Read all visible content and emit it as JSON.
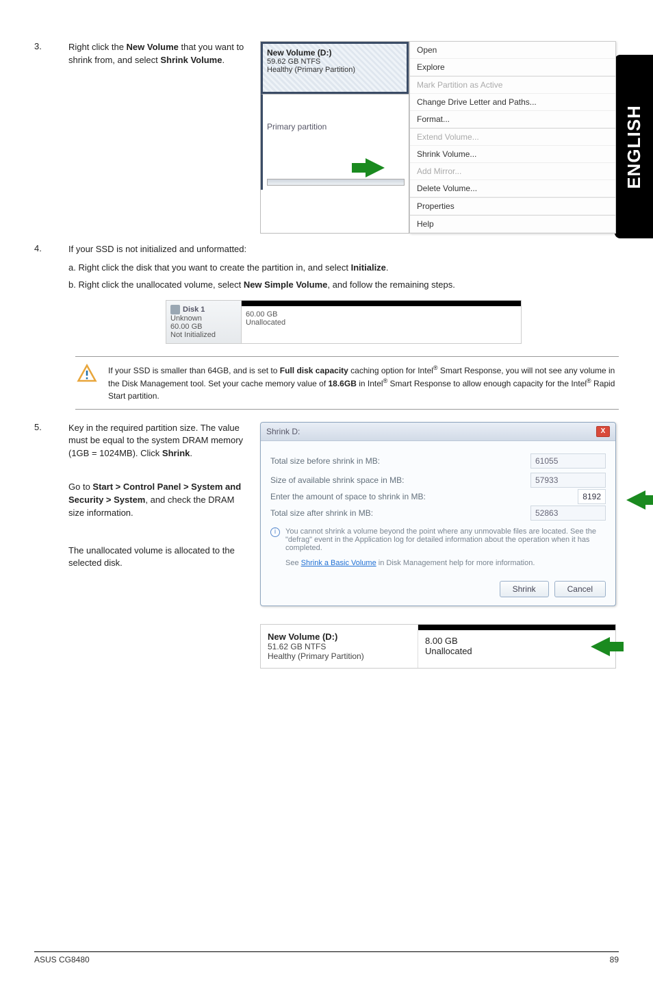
{
  "side_tab": "ENGLISH",
  "step3": {
    "num": "3.",
    "line1_a": "Right click the ",
    "line1_b": "New Volume",
    "line2": " that you want to shrink from, and select ",
    "line2_b": "Shrink Volume",
    "line2_c": "."
  },
  "ctx_volume": {
    "title": "New Volume  (D:)",
    "sub1": "59.62 GB NTFS",
    "sub2": "Healthy (Primary Partition)",
    "prim": "Primary partition"
  },
  "ctx_menu": {
    "open": "Open",
    "explore": "Explore",
    "mark": "Mark Partition as Active",
    "change": "Change Drive Letter and Paths...",
    "format": "Format...",
    "extend": "Extend Volume...",
    "shrink": "Shrink Volume...",
    "mirror": "Add Mirror...",
    "delete": "Delete Volume...",
    "props": "Properties",
    "help": "Help"
  },
  "step4": {
    "num": "4.",
    "line": "If your SSD is not initialized and unformatted:",
    "a_pre": "a. Right click the disk that you want to create the partition in, and select ",
    "a_b": "Initialize",
    "a_post": ".",
    "b_pre": "b. Right click the unallocated volume, select ",
    "b_b": "New Simple Volume",
    "b_post": ", and follow the remaining steps."
  },
  "disk1": {
    "name": "Disk 1",
    "unk": "Unknown",
    "size": "60.00 GB",
    "state": "Not Initialized",
    "right_size": "60.00 GB",
    "right_state": "Unallocated"
  },
  "note": {
    "l1a": "If your SSD is smaller than 64GB, and is set to ",
    "l1b": "Full disk capacity",
    "l1c": " caching option for Intel",
    "l2": " Smart Response, you will not see any volume in the Disk Management tool. Set your cache memory value of ",
    "l2b": "18.6GB",
    "l2c": " in Intel",
    "l3": " Smart Response to allow enough capacity for the Intel",
    "l4": " Rapid Start partition."
  },
  "step5": {
    "num": "5.",
    "line1": "Key in the required partition size. The value must be equal to the system DRAM memory (1GB = 1024MB). Click ",
    "line1b": "Shrink",
    "line1c": ".",
    "sub_a": "Go to ",
    "sub_b": "Start > Control Panel > System and Security > System",
    "sub_c": ", and check the DRAM size information.",
    "para2": "The unallocated volume is allocated to the selected disk."
  },
  "shrink_dlg": {
    "title": "Shrink D:",
    "r1": "Total size before shrink in MB:",
    "r1v": "61055",
    "r2": "Size of available shrink space in MB:",
    "r2v": "57933",
    "r3": "Enter the amount of space to shrink in MB:",
    "r3v": "8192",
    "r4": "Total size after shrink in MB:",
    "r4v": "52863",
    "info": "You cannot shrink a volume beyond the point where any unmovable files are located. See the \"defrag\" event in the Application log for detailed information about the operation when it has completed.",
    "see_a": "See ",
    "see_link": "Shrink a Basic Volume",
    "see_b": " in Disk Management help for more information.",
    "btn_shrink": "Shrink",
    "btn_cancel": "Cancel"
  },
  "result": {
    "t1": "New Volume  (D:)",
    "t2": "51.62 GB NTFS",
    "t3": "Healthy (Primary Partition)",
    "r_size": "8.00 GB",
    "r_state": "Unallocated"
  },
  "footer": {
    "left": "ASUS CG8480",
    "right": "89"
  }
}
